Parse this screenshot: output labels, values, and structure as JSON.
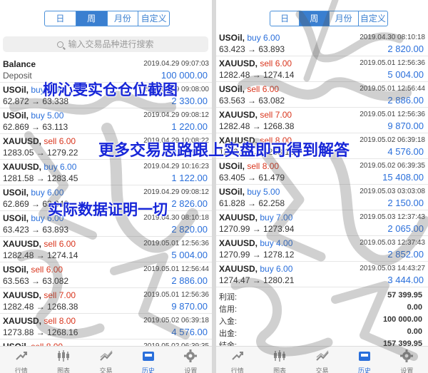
{
  "left": {
    "tabs": [
      "日",
      "周",
      "月份",
      "自定义"
    ],
    "search_placeholder": "输入交易品种进行搜索",
    "balance": {
      "title": "Balance",
      "date": "2019.04.29 09:07:03",
      "type": "Deposit",
      "amount": "100 000.00"
    },
    "trades": [
      {
        "symbol": "USOil",
        "side": "buy",
        "lots": "6.00",
        "date": "2019.04.29 09:08:00",
        "prices": "62.872 → 63.338",
        "profit": "2 330.00"
      },
      {
        "symbol": "USOil",
        "side": "buy",
        "lots": "5.00",
        "date": "2019.04.29 09:08:12",
        "prices": "62.869 → 63.113",
        "profit": "1 220.00"
      },
      {
        "symbol": "XAUUSD",
        "side": "sell",
        "lots": "6.00",
        "date": "2019.04.29 10:08:22",
        "prices": "1283.05 → 1279.22",
        "profit": "2 298.00"
      },
      {
        "symbol": "XAUUSD",
        "side": "buy",
        "lots": "6.00",
        "date": "2019.04.29 10:16:23",
        "prices": "1281.58 → 1283.45",
        "profit": "1 122.00"
      },
      {
        "symbol": "USOil",
        "side": "buy",
        "lots": "6.00",
        "date": "2019.04.29 09:08:12",
        "prices": "62.869 → 63.340",
        "profit": "2 826.00"
      },
      {
        "symbol": "USOil",
        "side": "buy",
        "lots": "6.00",
        "date": "2019.04.30 08:10:18",
        "prices": "63.423 → 63.893",
        "profit": "2 820.00"
      },
      {
        "symbol": "XAUUSD",
        "side": "sell",
        "lots": "6.00",
        "date": "2019.05.01 12:56:36",
        "prices": "1282.48 → 1274.14",
        "profit": "5 004.00"
      },
      {
        "symbol": "USOil",
        "side": "sell",
        "lots": "6.00",
        "date": "2019.05.01 12:56:44",
        "prices": "63.563 → 63.082",
        "profit": "2 886.00"
      },
      {
        "symbol": "XAUUSD",
        "side": "sell",
        "lots": "7.00",
        "date": "2019.05.01 12:56:36",
        "prices": "1282.48 → 1268.38",
        "profit": "9 870.00"
      },
      {
        "symbol": "XAUUSD",
        "side": "sell",
        "lots": "8.00",
        "date": "2019.05.02 06:39:18",
        "prices": "1273.88 → 1268.16",
        "profit": "4 576.00"
      },
      {
        "symbol": "USOil",
        "side": "sell",
        "lots": "8.00",
        "date": "2019.05.02 06:39:35",
        "prices": "",
        "profit": ""
      }
    ]
  },
  "right": {
    "tabs": [
      "日",
      "周",
      "月份",
      "自定义"
    ],
    "trades": [
      {
        "symbol": "USOil",
        "side": "buy",
        "lots": "6.00",
        "date": "2019.04.30 08:10:18",
        "prices": "63.423 → 63.893",
        "profit": "2 820.00"
      },
      {
        "symbol": "XAUUSD",
        "side": "sell",
        "lots": "6.00",
        "date": "2019.05.01 12:56:36",
        "prices": "1282.48 → 1274.14",
        "profit": "5 004.00"
      },
      {
        "symbol": "USOil",
        "side": "sell",
        "lots": "6.00",
        "date": "2019.05.01 12:56:44",
        "prices": "63.563 → 63.082",
        "profit": "2 886.00"
      },
      {
        "symbol": "XAUUSD",
        "side": "sell",
        "lots": "7.00",
        "date": "2019.05.01 12:56:36",
        "prices": "1282.48 → 1268.38",
        "profit": "9 870.00"
      },
      {
        "symbol": "XAUUSD",
        "side": "sell",
        "lots": "8.00",
        "date": "2019.05.02 06:39:18",
        "prices": "1273.88 → 1268.16",
        "profit": "4 576.00"
      },
      {
        "symbol": "USOil",
        "side": "sell",
        "lots": "8.00",
        "date": "2019.05.02 06:39:35",
        "prices": "63.405 → 61.479",
        "profit": "15 408.00"
      },
      {
        "symbol": "USOil",
        "side": "buy",
        "lots": "5.00",
        "date": "2019.05.03 03:03:08",
        "prices": "61.828 → 62.258",
        "profit": "2 150.00"
      },
      {
        "symbol": "XAUUSD",
        "side": "buy",
        "lots": "7.00",
        "date": "2019.05.03 12:37:43",
        "prices": "1270.99 → 1273.94",
        "profit": "2 065.00"
      },
      {
        "symbol": "XAUUSD",
        "side": "buy",
        "lots": "4.00",
        "date": "2019.05.03 12:37:43",
        "prices": "1270.99 → 1278.12",
        "profit": "2 852.00"
      },
      {
        "symbol": "XAUUSD",
        "side": "buy",
        "lots": "6.00",
        "date": "2019.05.03 14:43:27",
        "prices": "1274.47 → 1280.21",
        "profit": "3 444.00"
      }
    ],
    "summary": [
      {
        "label": "利润:",
        "value": "57 399.95"
      },
      {
        "label": "信用:",
        "value": "0.00"
      },
      {
        "label": "入金:",
        "value": "100 000.00"
      },
      {
        "label": "出金:",
        "value": "0.00"
      },
      {
        "label": "结余:",
        "value": "157 399.95"
      }
    ]
  },
  "tabbar": [
    "行情",
    "图表",
    "交易",
    "历史",
    "设置"
  ],
  "overlay": {
    "line1": "柳沁雯实仓仓位截图",
    "line2": "更多交易思路跟上实盘即可得到解答",
    "line3": "实际数据证明一切"
  },
  "colors": {
    "accent": "#2a6fdb",
    "sell": "#d9361e",
    "overlay_text": "#1726d8"
  }
}
